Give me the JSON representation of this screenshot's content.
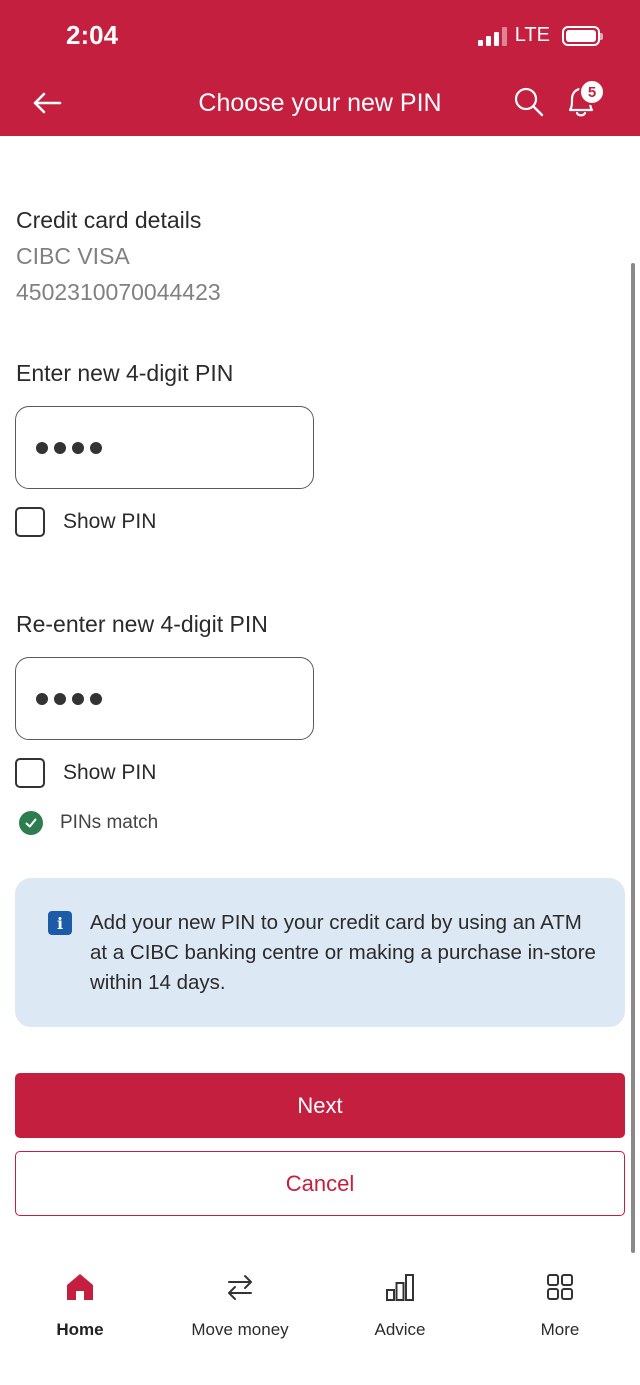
{
  "status_bar": {
    "time": "2:04",
    "network": "LTE"
  },
  "nav": {
    "title": "Choose your new PIN",
    "notification_count": "5",
    "icons": [
      "back-arrow-icon",
      "search-icon",
      "bell-icon"
    ]
  },
  "card_details": {
    "heading": "Credit card details",
    "card_name": "CIBC VISA",
    "card_number": "4502310070044423"
  },
  "pin_entry": {
    "label": "Enter new 4-digit PIN",
    "masked_value": "••••",
    "show_pin_label": "Show PIN"
  },
  "pin_reentry": {
    "label": "Re-enter new 4-digit PIN",
    "masked_value": "••••",
    "show_pin_label": "Show PIN"
  },
  "validation": {
    "match_text": "PINs match"
  },
  "info": {
    "text": "Add your new PIN to your credit card by using an ATM at a CIBC banking centre or making a purchase in-store within 14 days."
  },
  "actions": {
    "next_label": "Next",
    "cancel_label": "Cancel"
  },
  "tabbar": {
    "items": [
      {
        "label": "Home",
        "icon": "home-icon",
        "active": true
      },
      {
        "label": "Move money",
        "icon": "transfer-arrows-icon",
        "active": false
      },
      {
        "label": "Advice",
        "icon": "bar-chart-icon",
        "active": false
      },
      {
        "label": "More",
        "icon": "grid-icon",
        "active": false
      }
    ]
  },
  "colors": {
    "brand_red": "#c41f3e",
    "info_bg": "#dde8f5",
    "info_icon": "#1b5ba7",
    "success_green": "#2e7d4f"
  }
}
